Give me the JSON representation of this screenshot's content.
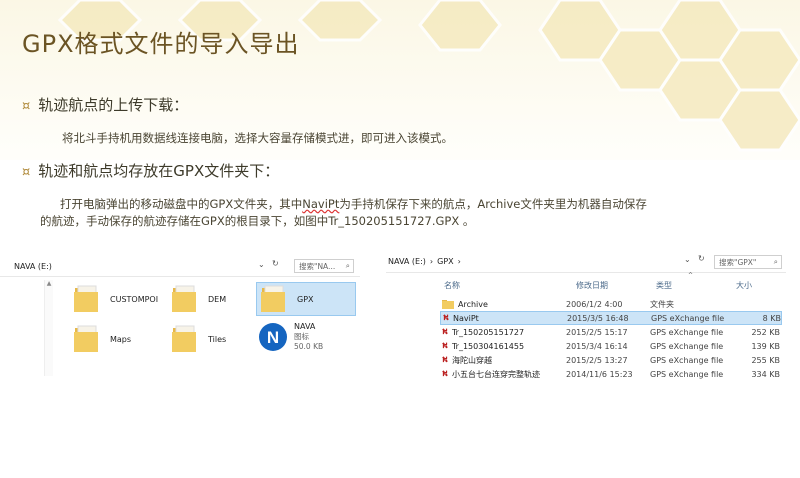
{
  "slide": {
    "title": "GPX格式文件的导入导出",
    "bullet1": "轨迹航点的上传下载：",
    "bullet1_text": "将北斗手持机用数据线连接电脑，选择大容量存储模式进，即可进入该模式。",
    "bullet2": "轨迹和航点均存放在GPX文件夹下：",
    "para2_a": "打开电脑弹出的移动磁盘中的GPX文件夹，其中",
    "para2_link": "NaviPt",
    "para2_b": "为手持机保存下来的航点，Archive文件夹里为机器自动保存",
    "para2_line2": "的航迹，手动保存的航迹存储在GPX的根目录下，如图中Tr_150205151727.GPX 。",
    "bullet_mark": "¤"
  },
  "left_pane": {
    "address": "NAVA (E:)",
    "search_placeholder": "搜索\"NA...",
    "items": [
      {
        "name": "CUSTOMPOI",
        "icon": "folder-icon"
      },
      {
        "name": "DEM",
        "icon": "folder-icon"
      },
      {
        "name": "GPX",
        "icon": "folder-icon"
      },
      {
        "name": "Maps",
        "icon": "folder-icon"
      },
      {
        "name": "Tiles",
        "icon": "folder-icon"
      },
      {
        "name": "NAVA",
        "sub1": "图标",
        "sub2": "50.0 KB",
        "icon": "nava-icon"
      }
    ]
  },
  "right_pane": {
    "address_1": "NAVA (E:)",
    "address_sep": "›",
    "address_2": "GPX",
    "search_placeholder": "搜索\"GPX\"",
    "columns": {
      "name": "名称",
      "date": "修改日期",
      "type": "类型",
      "size": "大小"
    },
    "rows": [
      {
        "name": "Archive",
        "date": "2006/1/2 4:00",
        "type": "文件夹",
        "size": "",
        "icon": "folder-icon"
      },
      {
        "name": "NaviPt",
        "date": "2015/3/5 16:48",
        "type": "GPS eXchange file",
        "size": "8 KB",
        "icon": "gpx-file-icon"
      },
      {
        "name": "Tr_150205151727",
        "date": "2015/2/5 15:17",
        "type": "GPS eXchange file",
        "size": "252 KB",
        "icon": "gpx-file-icon"
      },
      {
        "name": "Tr_150304161455",
        "date": "2015/3/4 16:14",
        "type": "GPS eXchange file",
        "size": "139 KB",
        "icon": "gpx-file-icon"
      },
      {
        "name": "海陀山穿越",
        "date": "2015/2/5 13:27",
        "type": "GPS eXchange file",
        "size": "255 KB",
        "icon": "gpx-file-icon"
      },
      {
        "name": "小五台七台连穿完整轨迹",
        "date": "2014/11/6 15:23",
        "type": "GPS eXchange file",
        "size": "334 KB",
        "icon": "gpx-file-icon"
      }
    ]
  },
  "colors": {
    "title": "#6b5424",
    "selection": "#cce4f7",
    "hex_fill": "#f6efc8"
  }
}
